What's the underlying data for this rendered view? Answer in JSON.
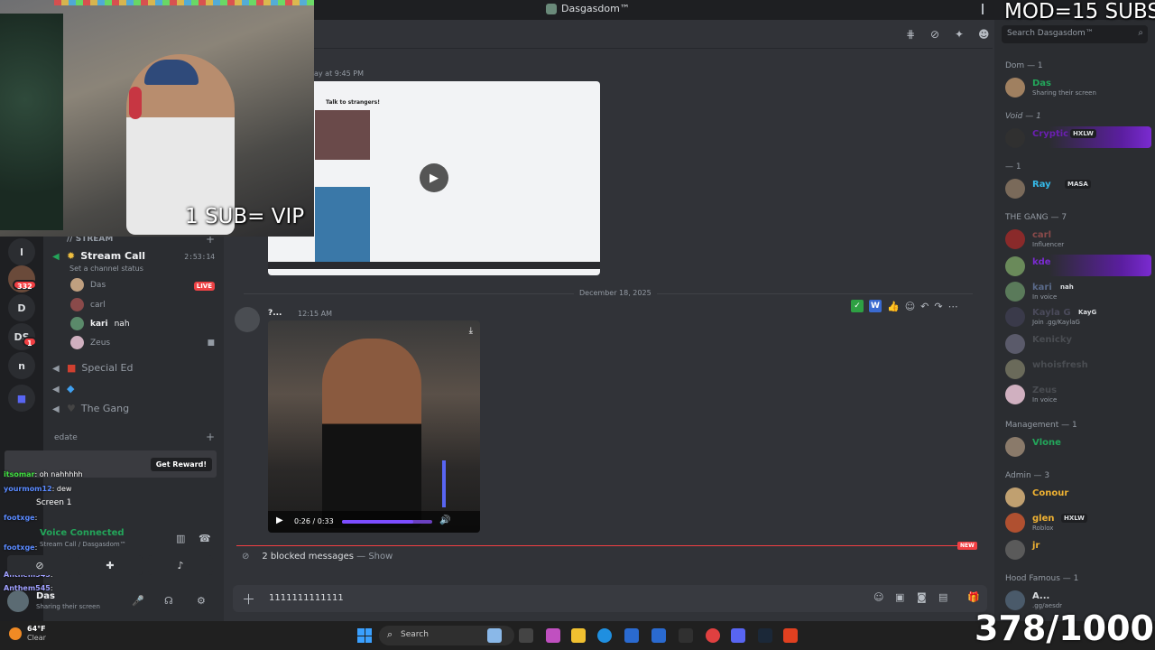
{
  "titlebar": {
    "server_title": "Dasgasdom™"
  },
  "overlays": {
    "webcam_caption": "1 SUB= VIP",
    "mod_goal": "MOD=15 SUBS",
    "sub_count": "378/1000"
  },
  "rail": {
    "items": [
      "l",
      "D",
      "DS",
      "n"
    ],
    "badge_count": "332",
    "ds_badge": "1",
    "new_label": "NEW"
  },
  "channels": {
    "category_stream": "// STREAM",
    "stream_call": {
      "label": "Stream Call",
      "status": "Set a channel status",
      "timer": "2:53:14"
    },
    "voice_users": [
      {
        "name": "Das",
        "live": "LIVE",
        "color": "#c0a080"
      },
      {
        "name": "carl",
        "live": "",
        "color": "#8a4a4a"
      },
      {
        "name": "kari",
        "tag": "nah",
        "live": "",
        "color": "#5a8a6a"
      },
      {
        "name": "Zeus",
        "live": "",
        "color": "#d0b0c0"
      }
    ],
    "special_ed": "Special Ed",
    "the_gang": "The Gang",
    "category_edate": "edate"
  },
  "overlay_chat": {
    "reward_button": "Get Reward!",
    "lines": [
      {
        "user": "itsomar",
        "text": ": oh nahhhhh"
      },
      {
        "user": "yourmom12",
        "text": ": dew"
      },
      {
        "user": "footxge",
        "text": ":"
      },
      {
        "user": "footxge",
        "text": ":"
      },
      {
        "user": "Anthem545",
        "text": ":"
      },
      {
        "user": "Anthem545",
        "text": ":"
      }
    ]
  },
  "voice_panel": {
    "connected": "Voice Connected",
    "location": "Stream Call / Dasgasdom™",
    "screen_label": "Screen 1",
    "user_name": "Das",
    "user_status": "Sharing their screen"
  },
  "chat": {
    "timestamp_top": "ay at 9:45 PM",
    "embed_heading": "Talk to strangers!",
    "date_separator": "December 18, 2025",
    "message_time": "12:15 AM",
    "message_author": "?...",
    "video_time": "0:26 / 0:33",
    "video_progress": 0.79,
    "new_label": "NEW",
    "blocked": "2 blocked messages",
    "show": "— Show",
    "composer_text": "1111111111111"
  },
  "members": {
    "search_placeholder": "Search Dasgasdom™",
    "roles": [
      {
        "label": "Dom — 1"
      },
      {
        "label": "Void — 1"
      },
      {
        "label": "— 1"
      },
      {
        "label": "THE GANG — 7"
      },
      {
        "label": "Management — 1"
      },
      {
        "label": "Admin — 3"
      },
      {
        "label": "Hood Famous — 1"
      }
    ],
    "list": [
      {
        "name": "Das",
        "sub": "Sharing their screen",
        "color": "#23a55a",
        "av": "#a08060"
      },
      {
        "name": "Cryptic",
        "tag": "HXLW",
        "sub": "",
        "color": "#6a1fb0",
        "av": "#303030",
        "hl": true
      },
      {
        "name": "Ray",
        "tag": "MASA",
        "sub": "",
        "color": "#35b9e8",
        "av": "#7a6a5a"
      },
      {
        "name": "carl",
        "sub": "Influencer",
        "color": "#8a4a4a",
        "av": "#8a2a2a"
      },
      {
        "name": "kde",
        "sub": "",
        "color": "#7a2bd0",
        "av": "#6a8a5a",
        "hl": true
      },
      {
        "name": "kari",
        "tag": "nah",
        "sub": "In voice",
        "color": "#5a6a8a",
        "av": "#5a7a5a"
      },
      {
        "name": "Kayla G",
        "tag": "KayG",
        "sub": "Join .gg/KaylaG",
        "color": "#4a4a5a",
        "av": "#3a3a4a"
      },
      {
        "name": "Kenicky",
        "sub": "",
        "color": "#4a4d52",
        "av": "#5a5a6a"
      },
      {
        "name": "whoisfresh",
        "sub": "",
        "color": "#4a4d52",
        "av": "#6a6a5a"
      },
      {
        "name": "Zeus",
        "sub": "In voice",
        "color": "#4a4d52",
        "av": "#d0b0c0"
      },
      {
        "name": "Vlone",
        "sub": "",
        "color": "#23a55a",
        "av": "#8a7a6a"
      },
      {
        "name": "Conour",
        "sub": "",
        "color": "#f0b232",
        "av": "#c0a070"
      },
      {
        "name": "glen",
        "tag": "HXLW",
        "sub": "Roblox",
        "color": "#f0b232",
        "av": "#b05030"
      },
      {
        "name": "jr",
        "sub": "",
        "color": "#f0b232",
        "av": "#5a5a5a"
      },
      {
        "name": "A...",
        "sub": ".gg/aesdr",
        "color": "#dbdee1",
        "av": "#4a5a6a"
      }
    ]
  },
  "taskbar": {
    "temp": "64°F",
    "condition": "Clear",
    "search": "Search"
  }
}
